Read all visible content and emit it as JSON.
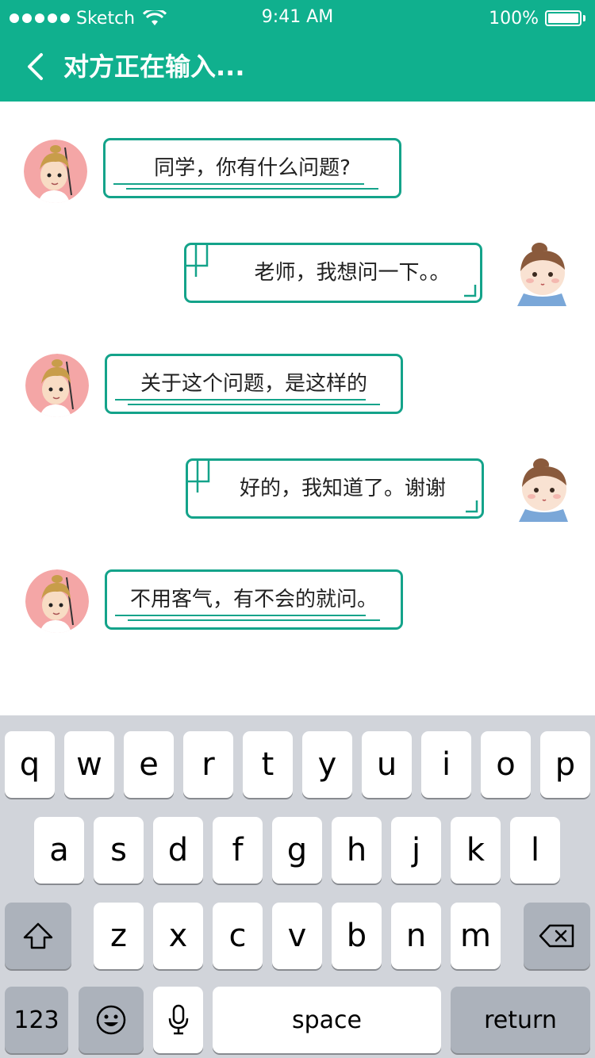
{
  "status_bar": {
    "carrier": "Sketch",
    "time": "9:41 AM",
    "battery": "100%"
  },
  "nav": {
    "title": "对方正在输入..."
  },
  "messages": [
    {
      "side": "left",
      "text": "同学，你有什么问题?"
    },
    {
      "side": "right",
      "text": "老师，我想问一下。。"
    },
    {
      "side": "left",
      "text": "关于这个问题，是这样的"
    },
    {
      "side": "right",
      "text": "好的，我知道了。谢谢"
    },
    {
      "side": "left",
      "text": "不用客气，有不会的就问。"
    }
  ],
  "keyboard": {
    "row1": [
      "q",
      "w",
      "e",
      "r",
      "t",
      "y",
      "u",
      "i",
      "o",
      "p"
    ],
    "row2": [
      "a",
      "s",
      "d",
      "f",
      "g",
      "h",
      "j",
      "k",
      "l"
    ],
    "row3": [
      "z",
      "x",
      "c",
      "v",
      "b",
      "n",
      "m"
    ],
    "numbers_label": "123",
    "space_label": "space",
    "return_label": "return"
  },
  "colors": {
    "accent": "#10b08e",
    "bubble_border": "#14a38a",
    "keyboard_bg": "#d1d4da"
  }
}
